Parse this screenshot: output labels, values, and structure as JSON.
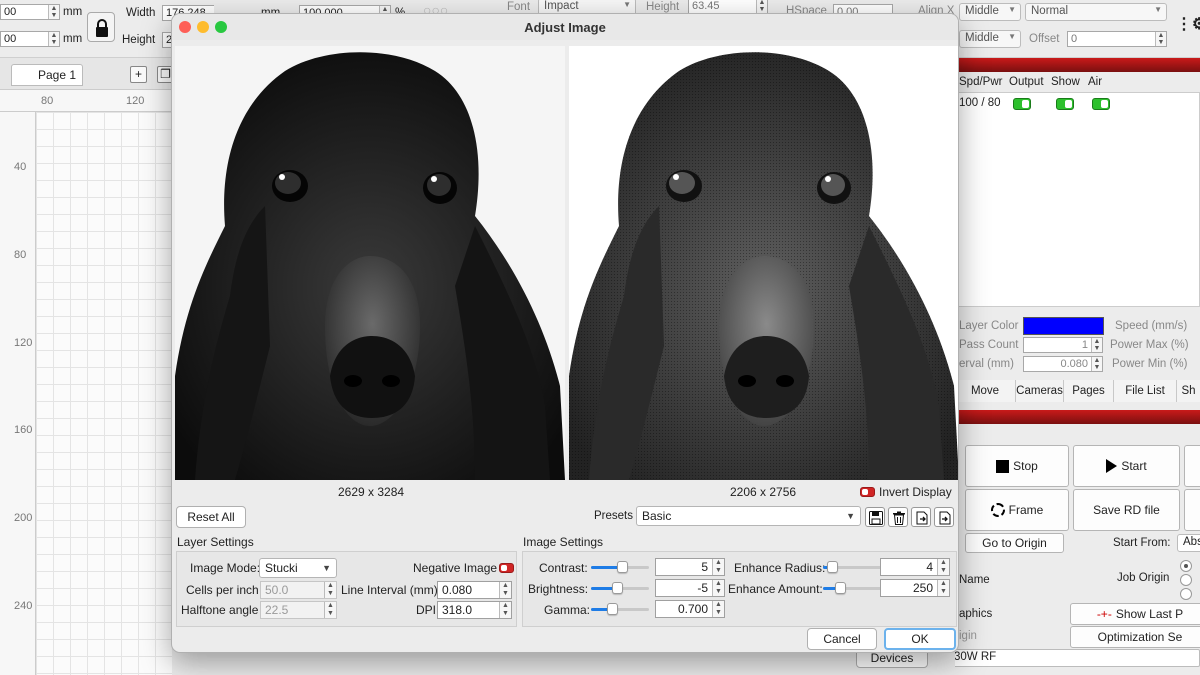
{
  "toolbar": {
    "x_value": "00",
    "y_value": "00",
    "unit1": "mm",
    "unit2": "mm",
    "width_label": "Width",
    "width_value": "176.248",
    "height_label": "Height",
    "height_value": "2",
    "unit3": "mm",
    "percent_value": "100.000",
    "percent_unit": "%",
    "font_label": "Font",
    "font_value": "Impact",
    "font_height_label": "Height",
    "font_height_value": "63.45",
    "hspace_label": "HSpace",
    "hspace_value": "0.00",
    "alignx_label": "Align X",
    "alignx_value": "Middle",
    "aligny_value": "Middle",
    "normal_value": "Normal",
    "offset_label": "Offset",
    "offset_value": "0"
  },
  "workspace": {
    "page_tab": "Page 1",
    "ruler_top": [
      "80",
      "120"
    ],
    "ruler_left": [
      "40",
      "80",
      "120",
      "160",
      "200",
      "240"
    ]
  },
  "right_panel": {
    "layer_headers": [
      "Spd/Pwr",
      "Output",
      "Show",
      "Air"
    ],
    "layer_row_speed": "100 / 80",
    "layer_color_label": "Layer Color",
    "layer_color": "#0000ff",
    "pass_count_label": "Pass Count",
    "pass_count_value": "1",
    "interval_label": "erval (mm)",
    "interval_value": "0.080",
    "speed_label": "Speed (mm/s)",
    "power_max_label": "Power Max (%)",
    "power_min_label": "Power Min (%)",
    "tabs": [
      "Move",
      "Cameras",
      "Pages",
      "File List",
      "Sh"
    ],
    "stop_label": "Stop",
    "start_label": "Start",
    "frame_label": "Frame",
    "save_rd_label": "Save RD file",
    "go_origin_label": "Go to Origin",
    "start_from_label": "Start From:",
    "start_from_value": "Abs",
    "name_label": "Name",
    "job_origin_label": "Job Origin",
    "graphics_label": "aphics",
    "show_last_label": "Show Last P",
    "origin_label": "igin",
    "optimization_label": "Optimization Se",
    "devices_label": "Devices",
    "device_value": "30W RF"
  },
  "dialog": {
    "title": "Adjust Image",
    "left_dims": "2629 x 3284",
    "right_dims": "2206 x 2756",
    "invert_label": "Invert Display",
    "reset_label": "Reset All",
    "presets_label": "Presets",
    "presets_value": "Basic",
    "layer_settings": {
      "header": "Layer Settings",
      "image_mode_label": "Image Mode:",
      "image_mode_value": "Stucki",
      "negative_label": "Negative Image",
      "cells_label": "Cells per inch",
      "cells_value": "50.0",
      "line_interval_label": "Line Interval (mm)",
      "line_interval_value": "0.080",
      "halftone_label": "Halftone angle",
      "halftone_value": "22.5",
      "dpi_label": "DPI",
      "dpi_value": "318.0"
    },
    "image_settings": {
      "header": "Image Settings",
      "contrast_label": "Contrast:",
      "contrast_value": "5",
      "contrast_level": 0.55,
      "brightness_label": "Brightness:",
      "brightness_value": "-5",
      "brightness_level": 0.45,
      "gamma_label": "Gamma:",
      "gamma_value": "0.700",
      "gamma_level": 0.35,
      "enhance_radius_label": "Enhance Radius:",
      "enhance_radius_value": "4",
      "enhance_radius_level": 0.08,
      "enhance_amount_label": "Enhance Amount:",
      "enhance_amount_value": "250",
      "enhance_amount_level": 0.25
    },
    "cancel_label": "Cancel",
    "ok_label": "OK"
  }
}
